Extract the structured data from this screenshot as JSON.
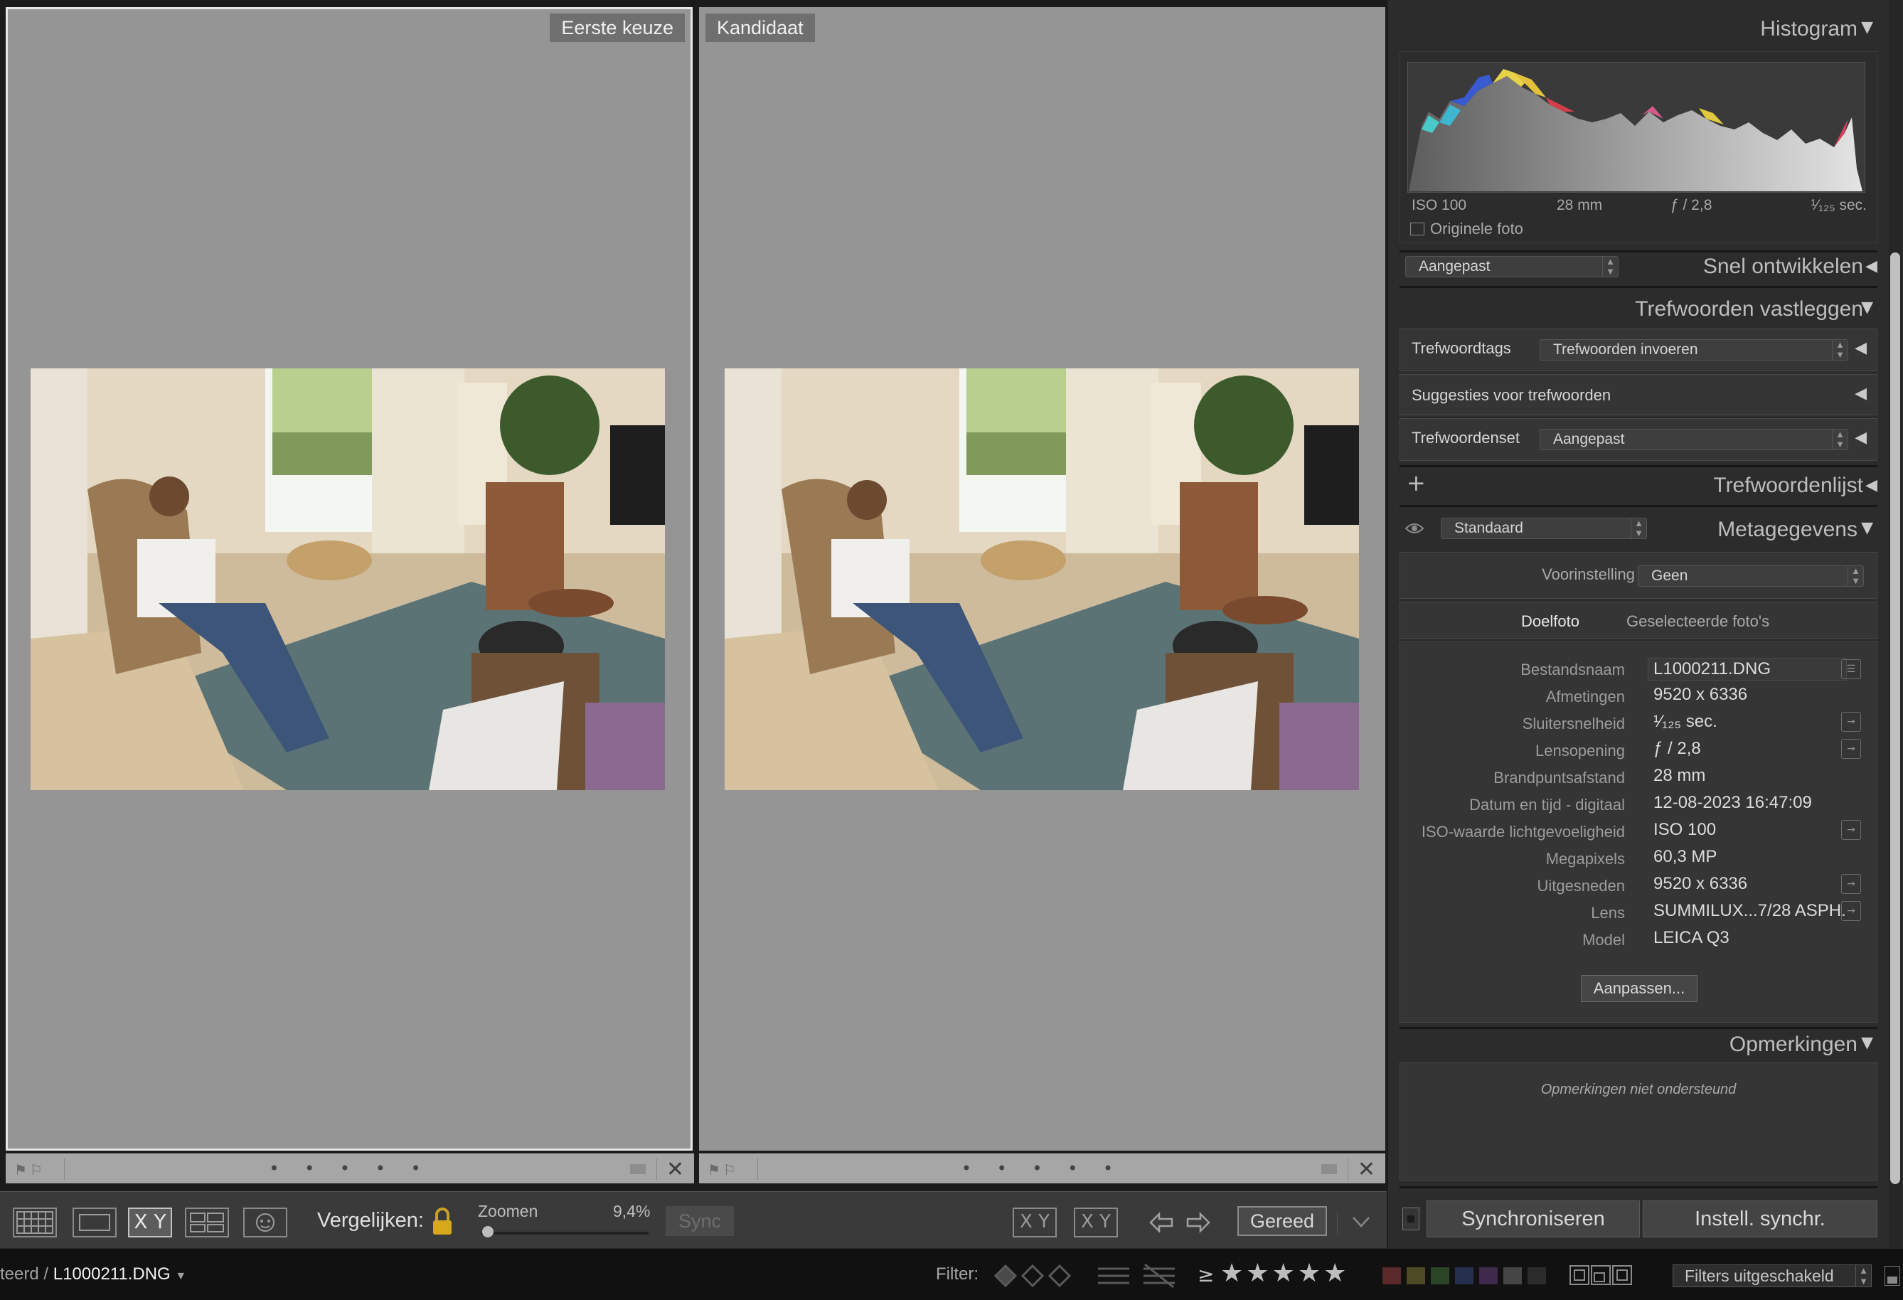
{
  "compare": {
    "left_label": "Eerste keuze",
    "right_label": "Kandidaat",
    "footer_dots": "• • • • •"
  },
  "toolbar": {
    "compare_label": "Vergelijken:",
    "zoom_label": "Zoomen",
    "zoom_value": "9,4%",
    "sync_label": "Sync",
    "done_label": "Gereed",
    "swap_label": "X Y",
    "make_select_label": "X Y",
    "grid_view_label": "X Y"
  },
  "histogram": {
    "title": "Histogram",
    "iso": "ISO 100",
    "focal": "28 mm",
    "aperture": "ƒ / 2,8",
    "shutter": "¹⁄₁₂₅ sec.",
    "original_photo": "Originele foto"
  },
  "quick_develop": {
    "title": "Snel ontwikkelen",
    "preset": "Aangepast"
  },
  "keywording": {
    "title": "Trefwoorden vastleggen",
    "tags_label": "Trefwoordtags",
    "tags_value": "Trefwoorden invoeren",
    "suggestions_label": "Suggesties voor trefwoorden",
    "set_label": "Trefwoordenset",
    "set_value": "Aangepast"
  },
  "keyword_list": {
    "title": "Trefwoordenlijst",
    "add": "+"
  },
  "metadata": {
    "title": "Metagegevens",
    "view": "Standaard",
    "preset_label": "Voorinstelling",
    "preset_value": "Geen",
    "target_photo": "Doelfoto",
    "selected_photos": "Geselecteerde foto's",
    "rows": [
      {
        "label": "Bestandsnaam",
        "value": "L1000211.DNG"
      },
      {
        "label": "Afmetingen",
        "value": "9520 x 6336"
      },
      {
        "label": "Sluitersnelheid",
        "value": "¹⁄₁₂₅ sec."
      },
      {
        "label": "Lensopening",
        "value": "ƒ / 2,8"
      },
      {
        "label": "Brandpuntsafstand",
        "value": "28 mm"
      },
      {
        "label": "Datum en tijd - digitaal",
        "value": "12-08-2023 16:47:09"
      },
      {
        "label": "ISO-waarde lichtgevoeligheid",
        "value": "ISO 100"
      },
      {
        "label": "Megapixels",
        "value": "60,3 MP"
      },
      {
        "label": "Uitgesneden",
        "value": "9520 x 6336"
      },
      {
        "label": "Lens",
        "value": "SUMMILUX...7/28 ASPH."
      },
      {
        "label": "Model",
        "value": "LEICA Q3"
      }
    ],
    "customize_button": "Aanpassen..."
  },
  "comments": {
    "title": "Opmerkingen",
    "placeholder": "Opmerkingen niet ondersteund"
  },
  "sync": {
    "sync_button": "Synchroniseren",
    "settings_button": "Instell. synchr."
  },
  "filmstrip": {
    "path_prefix": "teerd /",
    "filename": "L1000211.DNG",
    "filter_label": "Filter:",
    "rating_operator": "≥",
    "stars": "★★★★★",
    "filter_state": "Filters uitgeschakeld"
  },
  "colors": {
    "label_red": "#5a2a2a",
    "label_yellow": "#4e4a24",
    "label_green": "#2c4428",
    "label_blue": "#26304e",
    "label_purple": "#3e2a4a"
  }
}
